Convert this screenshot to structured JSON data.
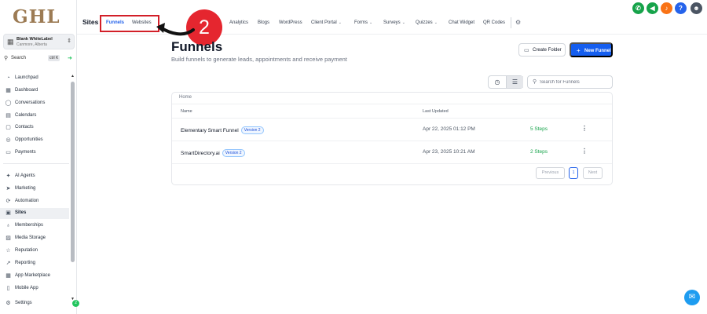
{
  "sidebar": {
    "logo": "GHL",
    "account": {
      "name": "Blank WhiteLabel",
      "location": "Canmore, Alberta"
    },
    "search": {
      "label": "Search",
      "shortcut": "ctrl K"
    },
    "items": [
      {
        "label": "Launchpad",
        "icon": "rocket-icon"
      },
      {
        "label": "Dashboard",
        "icon": "dashboard-icon"
      },
      {
        "label": "Conversations",
        "icon": "chat-icon"
      },
      {
        "label": "Calendars",
        "icon": "calendar-icon"
      },
      {
        "label": "Contacts",
        "icon": "contacts-icon"
      },
      {
        "label": "Opportunities",
        "icon": "target-icon"
      },
      {
        "label": "Payments",
        "icon": "payment-icon"
      },
      {
        "label": "AI Agents",
        "icon": "sparkle-icon"
      },
      {
        "label": "Marketing",
        "icon": "send-icon"
      },
      {
        "label": "Automation",
        "icon": "automation-icon"
      },
      {
        "label": "Sites",
        "icon": "sites-icon",
        "active": true
      },
      {
        "label": "Memberships",
        "icon": "membership-icon"
      },
      {
        "label": "Media Storage",
        "icon": "media-icon"
      },
      {
        "label": "Reputation",
        "icon": "star-icon"
      },
      {
        "label": "Reporting",
        "icon": "chart-icon"
      },
      {
        "label": "App Marketplace",
        "icon": "grid-icon"
      },
      {
        "label": "Mobile App",
        "icon": "mobile-icon"
      },
      {
        "label": "Settings",
        "icon": "gear-icon"
      }
    ],
    "badge": "2"
  },
  "topbar": {
    "title": "Sites",
    "tabs": [
      {
        "label": "Funnels",
        "active": true
      },
      {
        "label": "Websites"
      },
      {
        "label": "Analytics"
      },
      {
        "label": "Blogs"
      },
      {
        "label": "WordPress"
      },
      {
        "label": "Client Portal",
        "dropdown": true
      },
      {
        "label": "Forms",
        "dropdown": true
      },
      {
        "label": "Surveys",
        "dropdown": true
      },
      {
        "label": "Quizzes",
        "dropdown": true
      },
      {
        "label": "Chat Widget"
      },
      {
        "label": "QR Codes"
      }
    ],
    "annotation_number": "2",
    "icons": [
      {
        "name": "phone-icon",
        "color": "#16a34a",
        "glyph": "✆"
      },
      {
        "name": "megaphone-icon",
        "color": "#16a34a",
        "glyph": "◀"
      },
      {
        "name": "bell-icon",
        "color": "#f97316",
        "glyph": "🔔"
      },
      {
        "name": "help-icon",
        "color": "#2563eb",
        "glyph": "?"
      }
    ]
  },
  "main": {
    "title": "Funnels",
    "subtitle": "Build funnels to generate leads, appointments and receive payment",
    "create_folder": "Create Folder",
    "new_funnel": "New Funnel",
    "search_placeholder": "Search for Funnels",
    "breadcrumb": "Home",
    "columns": {
      "name": "Name",
      "updated": "Last Updated"
    },
    "rows": [
      {
        "name": "Elementary Smart Funnel",
        "version": "Version 2",
        "updated": "Apr 22, 2025 01:12 PM",
        "steps": "5 Steps"
      },
      {
        "name": "SmartDirectory.ai",
        "version": "Version 2",
        "updated": "Apr 23, 2025 10:21 AM",
        "steps": "2 Steps"
      }
    ],
    "pagination": {
      "previous": "Previous",
      "current": "1",
      "next": "Next"
    }
  },
  "colors": {
    "accent": "#155eef",
    "highlight": "#d21f28",
    "steps": "#16a34a",
    "logo": "#9c7b54"
  }
}
